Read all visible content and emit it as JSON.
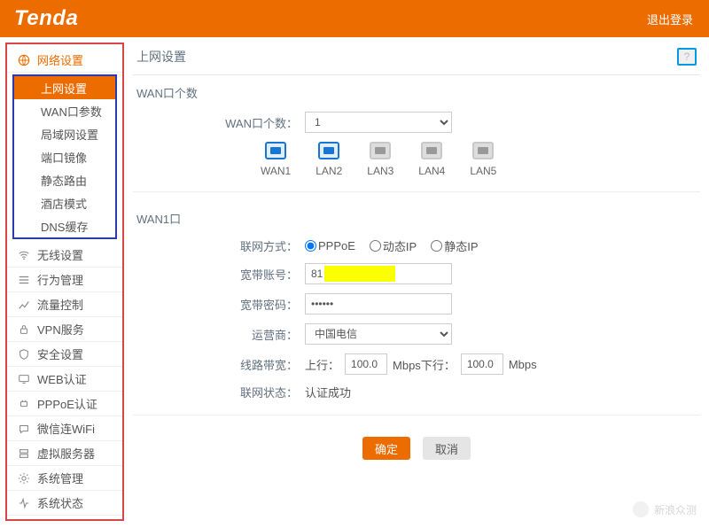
{
  "header": {
    "logo": "Tenda",
    "logout": "退出登录"
  },
  "sidebar": {
    "parent_active": "网络设置",
    "sub_items": [
      "上网设置",
      "WAN口参数",
      "局域网设置",
      "端口镜像",
      "静态路由",
      "酒店模式",
      "DNS缓存"
    ],
    "sub_active": "上网设置",
    "items": [
      "无线设置",
      "行为管理",
      "流量控制",
      "VPN服务",
      "安全设置",
      "WEB认证",
      "PPPoE认证",
      "微信连WiFi",
      "虚拟服务器",
      "系统管理",
      "系统状态"
    ]
  },
  "page": {
    "title": "上网设置",
    "help": "?"
  },
  "wan_count": {
    "section": "WAN口个数",
    "label": "WAN口个数：",
    "value": "1",
    "options": [
      "1"
    ],
    "ports": [
      {
        "name": "WAN1",
        "active": true
      },
      {
        "name": "LAN2",
        "active": true
      },
      {
        "name": "LAN3",
        "active": false
      },
      {
        "name": "LAN4",
        "active": false
      },
      {
        "name": "LAN5",
        "active": false
      }
    ]
  },
  "wan1": {
    "section": "WAN1口",
    "conn_label": "联网方式：",
    "conn_options": [
      "PPPoE",
      "动态IP",
      "静态IP"
    ],
    "conn_selected": "PPPoE",
    "user_label": "宽带账号：",
    "user_value": "81",
    "pass_label": "宽带密码：",
    "pass_value": "••••••",
    "isp_label": "运营商：",
    "isp_value": "中国电信",
    "isp_options": [
      "中国电信"
    ],
    "bw_label": "线路带宽：",
    "bw_up_label": "上行：",
    "bw_up_value": "100.0",
    "bw_unit1": "Mbps",
    "bw_down_label": "下行：",
    "bw_down_value": "100.0",
    "bw_unit2": "Mbps",
    "status_label": "联网状态：",
    "status_value": "认证成功"
  },
  "buttons": {
    "ok": "确定",
    "cancel": "取消"
  },
  "watermark": "新浪众测"
}
